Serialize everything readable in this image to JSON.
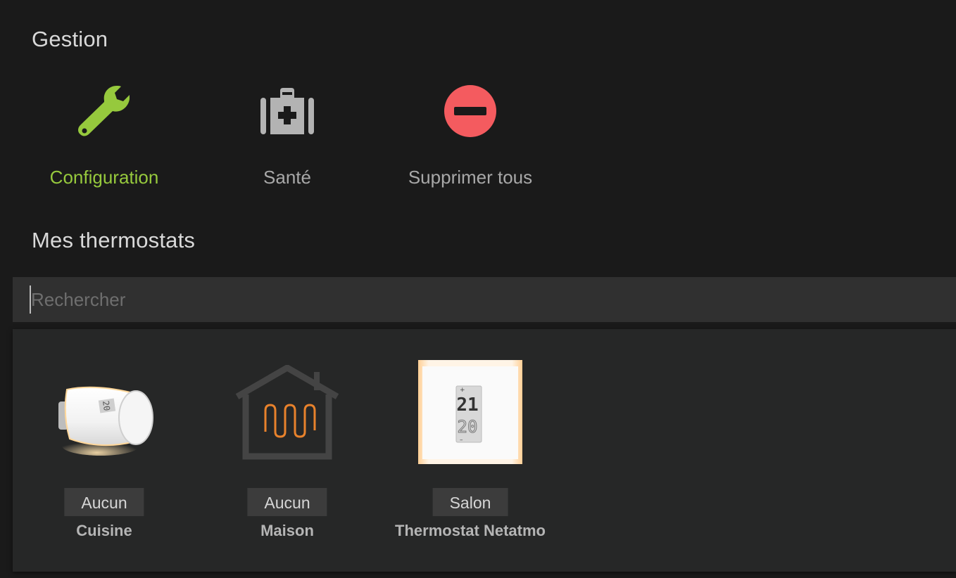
{
  "gestion": {
    "title": "Gestion",
    "actions": [
      {
        "id": "configuration",
        "label": "Configuration",
        "icon": "wrench-icon",
        "color": "#96c93d",
        "active": true
      },
      {
        "id": "sante",
        "label": "Santé",
        "icon": "medical-kit-icon",
        "color": "#b3b3b3",
        "active": false
      },
      {
        "id": "supprimer",
        "label": "Supprimer tous",
        "icon": "minus-circle-icon",
        "color": "#f45b5f",
        "active": false
      }
    ]
  },
  "thermostats": {
    "title": "Mes thermostats",
    "search": {
      "placeholder": "Rechercher",
      "value": ""
    },
    "devices": [
      {
        "name": "Cuisine",
        "room": "Aucun",
        "image": "netatmo-valve-image"
      },
      {
        "name": "Maison",
        "room": "Aucun",
        "image": "house-heating-icon"
      },
      {
        "name": "Thermostat Netatmo",
        "room": "Salon",
        "image": "netatmo-thermostat-image",
        "display_current": "21",
        "display_setpoint": "20"
      }
    ]
  },
  "colors": {
    "accent": "#96c93d",
    "danger": "#f45b5f",
    "heating": "#e8822c"
  }
}
